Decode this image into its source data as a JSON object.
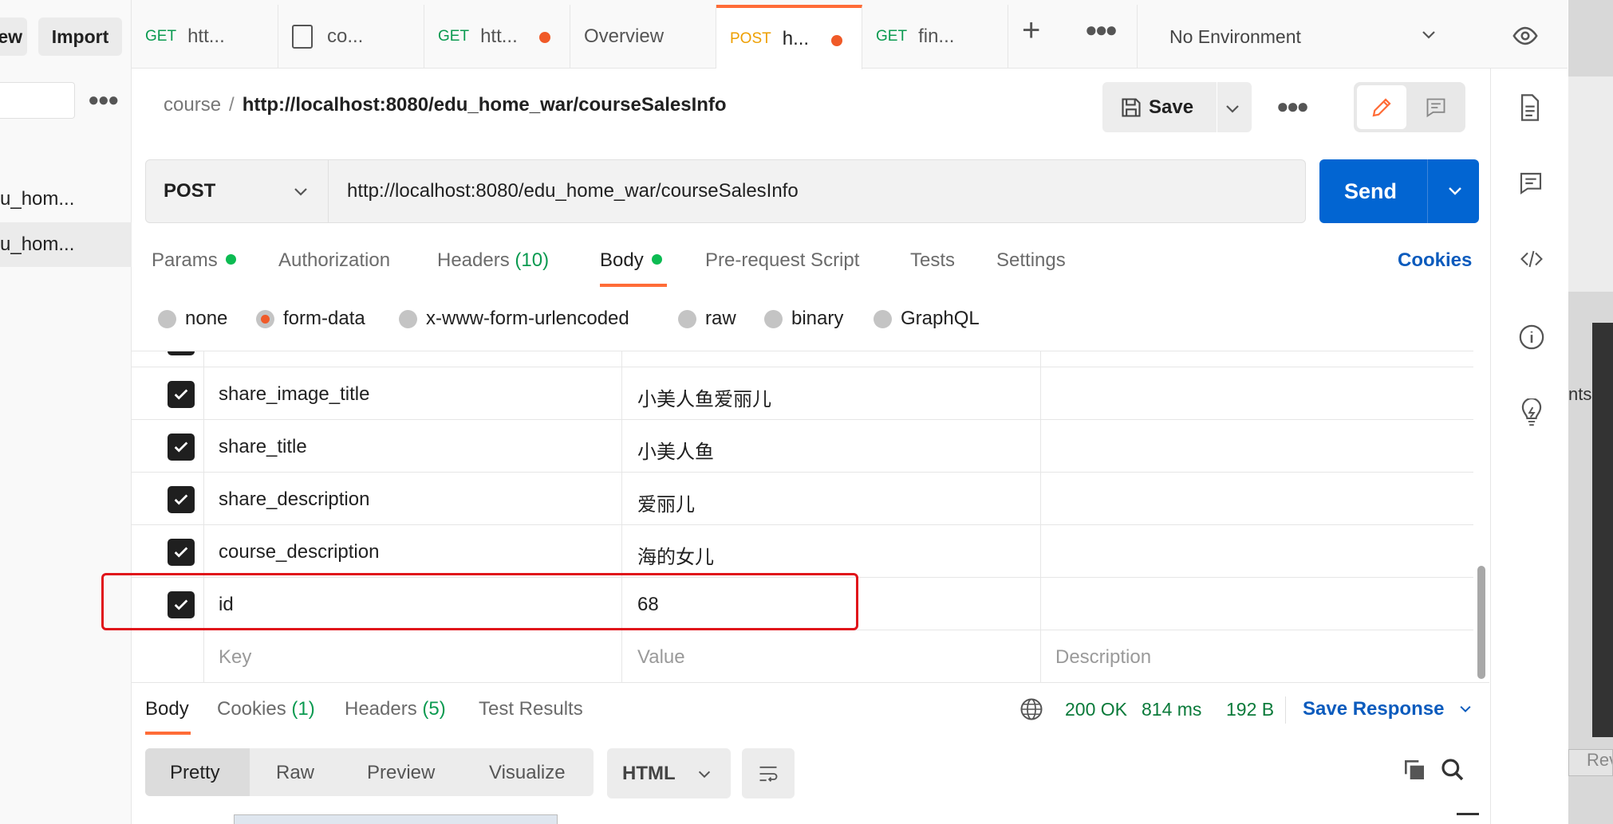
{
  "sidebar": {
    "new_label": "ew",
    "import_label": "Import",
    "items": [
      {
        "label": "u_hom..."
      },
      {
        "label": "u_hom..."
      }
    ]
  },
  "tabs": [
    {
      "method": "GET",
      "label": "htt...",
      "dot": false
    },
    {
      "method": "",
      "label": "co...",
      "dot": false
    },
    {
      "method": "GET",
      "label": "htt...",
      "dot": true
    },
    {
      "method": "",
      "label": "Overview",
      "dot": false
    },
    {
      "method": "POST",
      "label": "h...",
      "dot": true
    },
    {
      "method": "GET",
      "label": "fin...",
      "dot": false
    }
  ],
  "environment": "No Environment",
  "header": {
    "collection": "course",
    "separator": "/",
    "request_name": "http://localhost:8080/edu_home_war/courseSalesInfo",
    "save_label": "Save"
  },
  "request": {
    "method": "POST",
    "url": "http://localhost:8080/edu_home_war/courseSalesInfo",
    "send_label": "Send"
  },
  "request_tabs": {
    "params": "Params",
    "authorization": "Authorization",
    "headers": "Headers",
    "headers_count": "(10)",
    "body": "Body",
    "prerequest": "Pre-request Script",
    "tests": "Tests",
    "settings": "Settings",
    "cookies": "Cookies"
  },
  "body_types": {
    "none": "none",
    "form_data": "form-data",
    "urlencoded": "x-www-form-urlencoded",
    "raw": "raw",
    "binary": "binary",
    "graphql": "GraphQL",
    "selected": "form-data"
  },
  "params": [
    {
      "key": "share_image_title",
      "value": "小美人鱼爱丽儿",
      "checked": true
    },
    {
      "key": "share_title",
      "value": "小美人鱼",
      "checked": true
    },
    {
      "key": "share_description",
      "value": "爱丽儿",
      "checked": true
    },
    {
      "key": "course_description",
      "value": "海的女儿",
      "checked": true
    },
    {
      "key": "id",
      "value": "68",
      "checked": true
    }
  ],
  "param_placeholders": {
    "key": "Key",
    "value": "Value",
    "description": "Description"
  },
  "response_tabs": {
    "body": "Body",
    "cookies": "Cookies",
    "cookies_count": "(1)",
    "headers": "Headers",
    "headers_count": "(5)",
    "tests": "Test Results"
  },
  "response_status": {
    "status": "200 OK",
    "time": "814 ms",
    "size": "192 B",
    "save_response": "Save Response"
  },
  "view_modes": {
    "pretty": "Pretty",
    "raw": "Raw",
    "preview": "Preview",
    "visualize": "Visualize",
    "format": "HTML"
  },
  "background_window": {
    "text1": "nts",
    "text2": "Rev"
  },
  "colors": {
    "accent": "#ff6c37",
    "send": "#0265d2",
    "link": "#0b5bbd",
    "success": "#0a9a50",
    "highlight": "#e0131a"
  }
}
